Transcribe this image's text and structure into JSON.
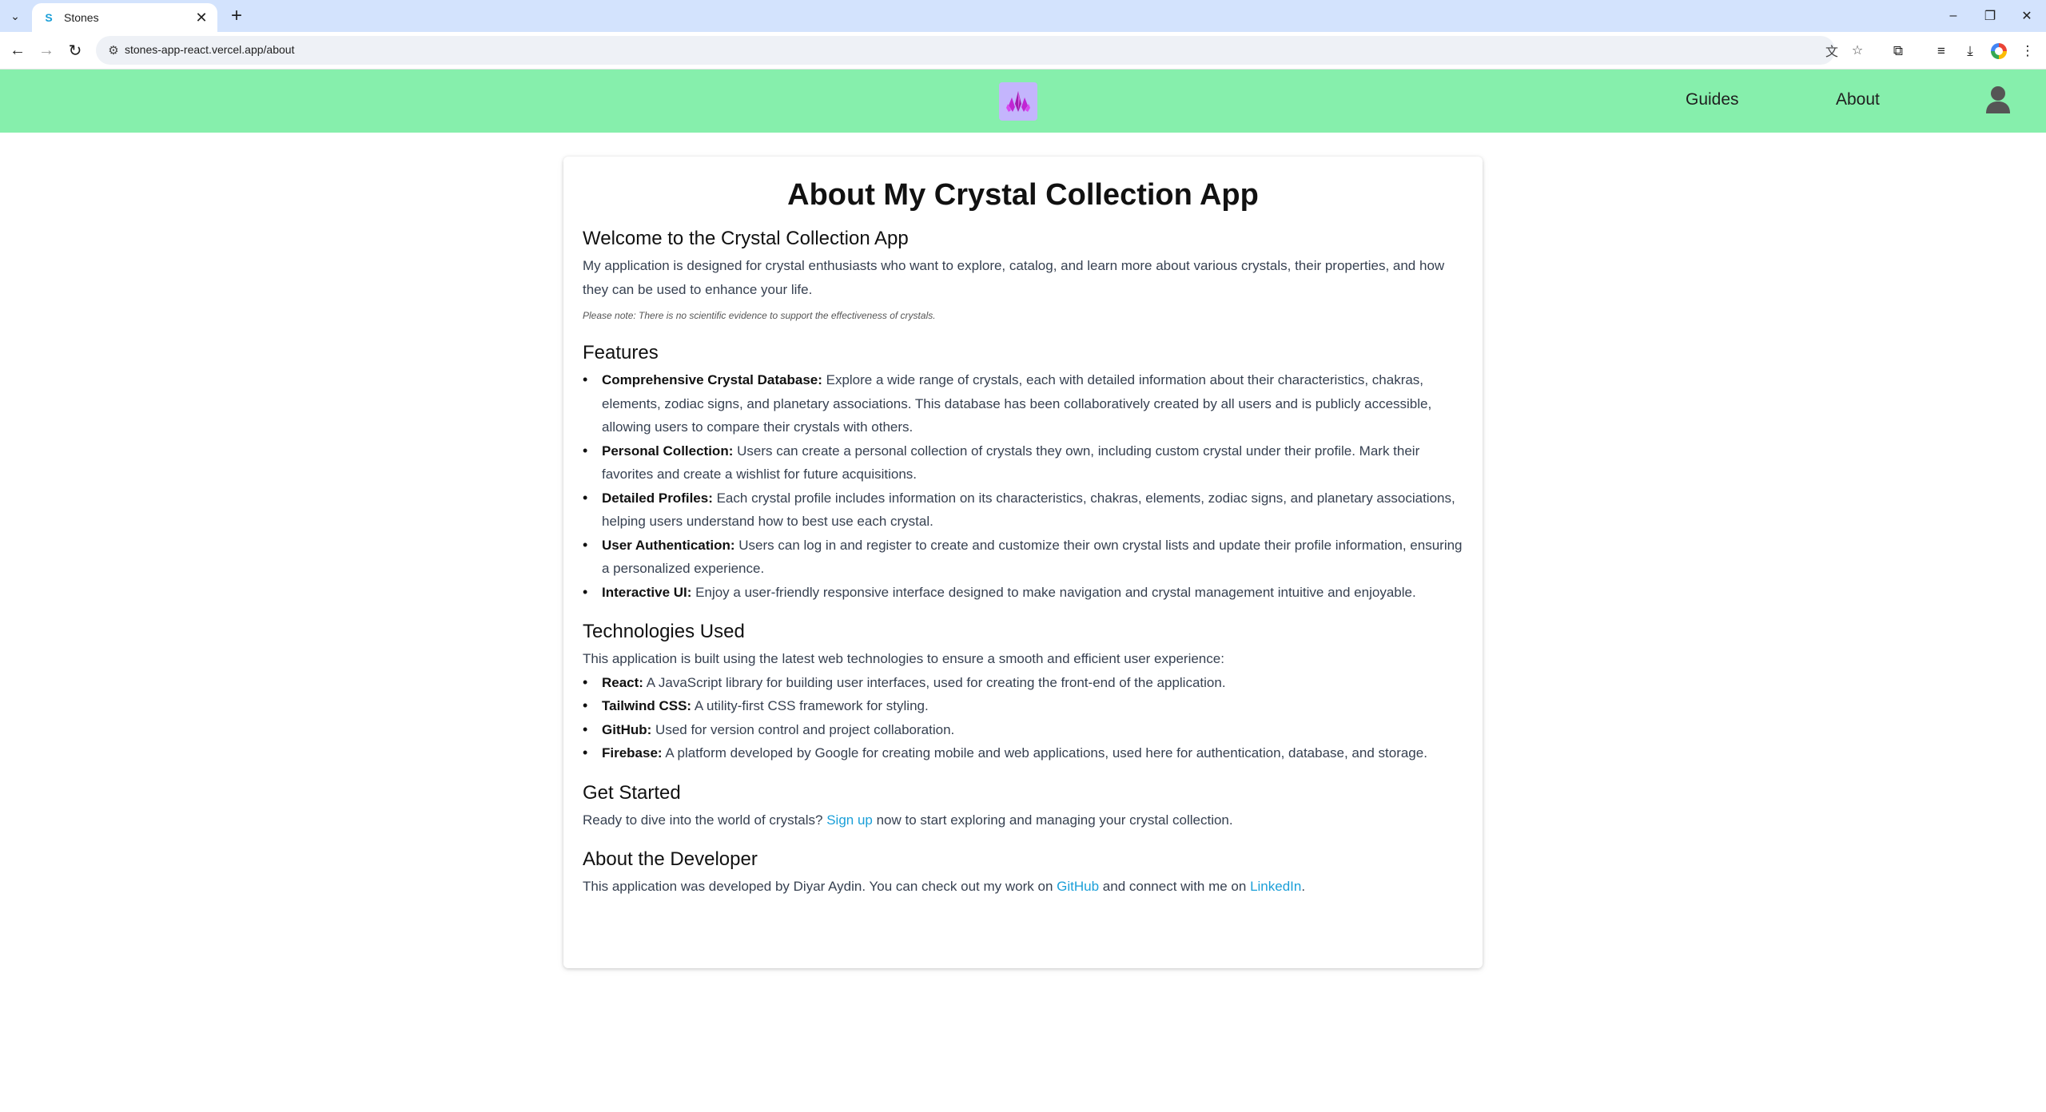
{
  "browser": {
    "tab_title": "Stones",
    "favicon_letter": "S",
    "url": "stones-app-react.vercel.app/about"
  },
  "header": {
    "nav": [
      "Guides",
      "About"
    ],
    "colors": {
      "header_bg": "#86efac",
      "logo_bg": "#c4b5fd",
      "link": "#1a9fd8"
    }
  },
  "page": {
    "title": "About My Crystal Collection App",
    "welcome": {
      "heading": "Welcome to the Crystal Collection App",
      "text": "My application is designed for crystal enthusiasts who want to explore, catalog, and learn more about various crystals, their properties, and how they can be used to enhance your life.",
      "note": "Please note: There is no scientific evidence to support the effectiveness of crystals."
    },
    "features": {
      "heading": "Features",
      "items": [
        {
          "label": "Comprehensive Crystal Database:",
          "text": " Explore a wide range of crystals, each with detailed information about their characteristics, chakras, elements, zodiac signs, and planetary associations. This database has been collaboratively created by all users and is publicly accessible, allowing users to compare their crystals with others."
        },
        {
          "label": "Personal Collection:",
          "text": " Users can create a personal collection of crystals they own, including custom crystal under their profile. Mark their favorites and create a wishlist for future acquisitions."
        },
        {
          "label": "Detailed Profiles:",
          "text": " Each crystal profile includes information on its characteristics, chakras, elements, zodiac signs, and planetary associations, helping users understand how to best use each crystal."
        },
        {
          "label": "User Authentication:",
          "text": " Users can log in and register to create and customize their own crystal lists and update their profile information, ensuring a personalized experience."
        },
        {
          "label": "Interactive UI:",
          "text": " Enjoy a user-friendly responsive interface designed to make navigation and crystal management intuitive and enjoyable."
        }
      ]
    },
    "technologies": {
      "heading": "Technologies Used",
      "intro": "This application is built using the latest web technologies to ensure a smooth and efficient user experience:",
      "items": [
        {
          "label": "React:",
          "text": " A JavaScript library for building user interfaces, used for creating the front-end of the application."
        },
        {
          "label": "Tailwind CSS:",
          "text": " A utility-first CSS framework for styling."
        },
        {
          "label": "GitHub:",
          "text": " Used for version control and project collaboration."
        },
        {
          "label": "Firebase:",
          "text": " A platform developed by Google for creating mobile and web applications, used here for authentication, database, and storage."
        }
      ]
    },
    "get_started": {
      "heading": "Get Started",
      "before": "Ready to dive into the world of crystals? ",
      "link": "Sign up",
      "after": " now to start exploring and managing your crystal collection."
    },
    "developer": {
      "heading": "About the Developer",
      "before": "This application was developed by Diyar Aydin. You can check out my work on ",
      "link1": "GitHub",
      "middle": " and connect with me on ",
      "link2": "LinkedIn",
      "after": "."
    }
  }
}
